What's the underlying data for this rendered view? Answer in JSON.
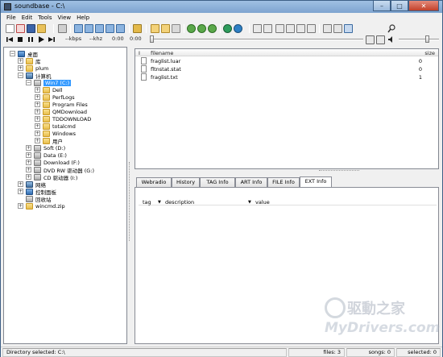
{
  "window": {
    "title": "soundbase - C:\\"
  },
  "menu": [
    "File",
    "Edit",
    "Tools",
    "View",
    "Help"
  ],
  "player": {
    "bitrate": "--kbps",
    "freq": "--khz",
    "time_current": "0:00",
    "time_total": "0:00"
  },
  "tree": {
    "desktop": "桌面",
    "library": "库",
    "plum": "plum",
    "computer": "计算机",
    "win7": "Win7 (C:)",
    "c_folders": [
      "Dell",
      "PerfLogs",
      "Program Files",
      "QMDownload",
      "TDDOWNLOAD",
      "totalcmd",
      "Windows",
      "用户"
    ],
    "soft": "Soft (D:)",
    "data": "Data (E:)",
    "download": "Download (F:)",
    "dvd": "DVD RW 驱动器 (G:)",
    "cd": "CD 驱动器 (I:)",
    "network": "网络",
    "control_panel": "控制面板",
    "recycle": "回收站",
    "wincmd": "wincmd.zip"
  },
  "filelist": {
    "col_icon": "I",
    "col_filename": "filename",
    "col_size": "size",
    "files": [
      {
        "name": "fraglist.luar",
        "size": "0"
      },
      {
        "name": "fltnstat.stat",
        "size": "0"
      },
      {
        "name": "fraglist.txt",
        "size": "1"
      }
    ]
  },
  "tabs": [
    "Webradio",
    "History",
    "TAG Info",
    "ART Info",
    "FILE Info",
    "EXT Info"
  ],
  "active_tab": "EXT Info",
  "ext_info": {
    "col_tag": "tag",
    "col_description": "description",
    "col_value": "value"
  },
  "status": {
    "directory": "Directory selected: C:\\",
    "files": "files: 3",
    "songs": "songs: 0",
    "selected": "selected: 0"
  },
  "watermark": {
    "top": "驱動之家",
    "bottom": "MyDrivers.com"
  }
}
